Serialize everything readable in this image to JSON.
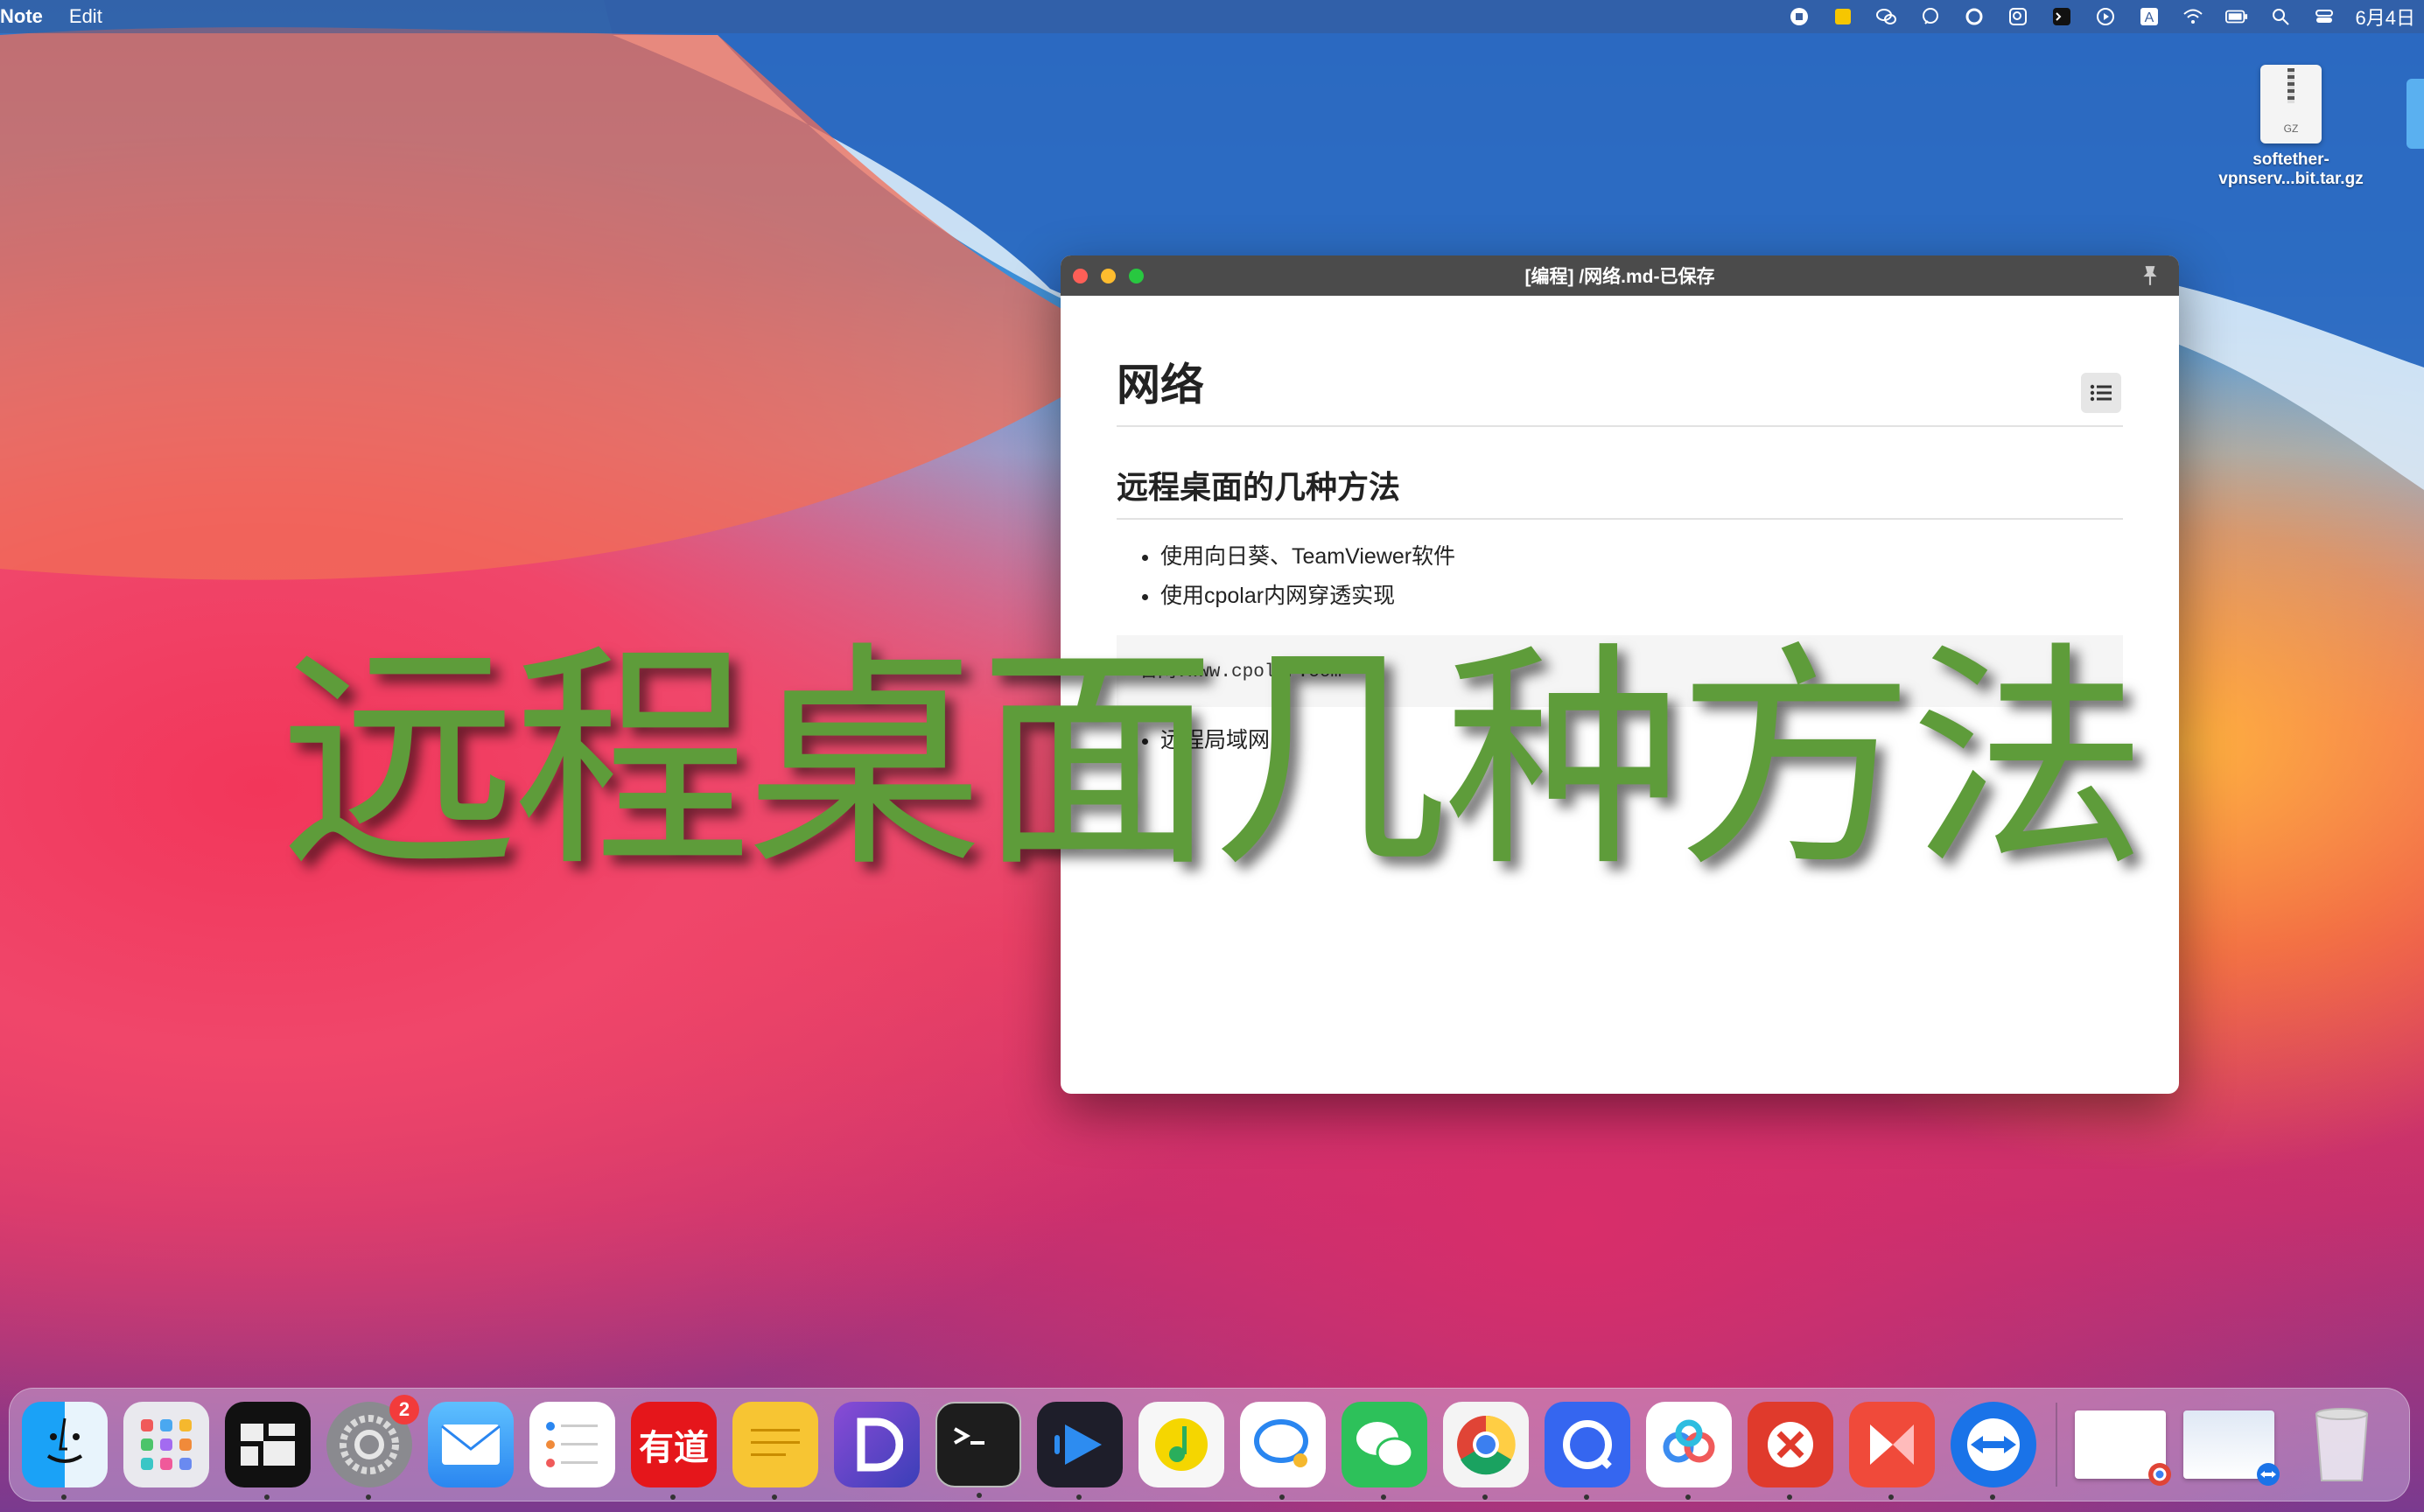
{
  "menubar": {
    "app_name": "Note",
    "menus": [
      "Edit"
    ],
    "date": "6月4日"
  },
  "desktop": {
    "files": [
      {
        "name_line1": "softether-",
        "name_line2": "vpnserv...bit.tar.gz",
        "badge": "GZ"
      }
    ]
  },
  "window": {
    "title": "[编程] /网络.md-已保存",
    "h1": "网络",
    "h2": "远程桌面的几种方法",
    "list1": [
      "使用向日葵、TeamViewer软件",
      "使用cpolar内网穿透实现"
    ],
    "code": "官网:www.cpolar.com",
    "list2": [
      "远程局域网"
    ]
  },
  "overlay": {
    "text": "远程桌面几种方法"
  },
  "dock": {
    "settings_badge": "2",
    "youdao_label": "有道"
  },
  "colors": {
    "overlay_green": "#5e9c3a",
    "titlebar": "#4b4b4b"
  }
}
